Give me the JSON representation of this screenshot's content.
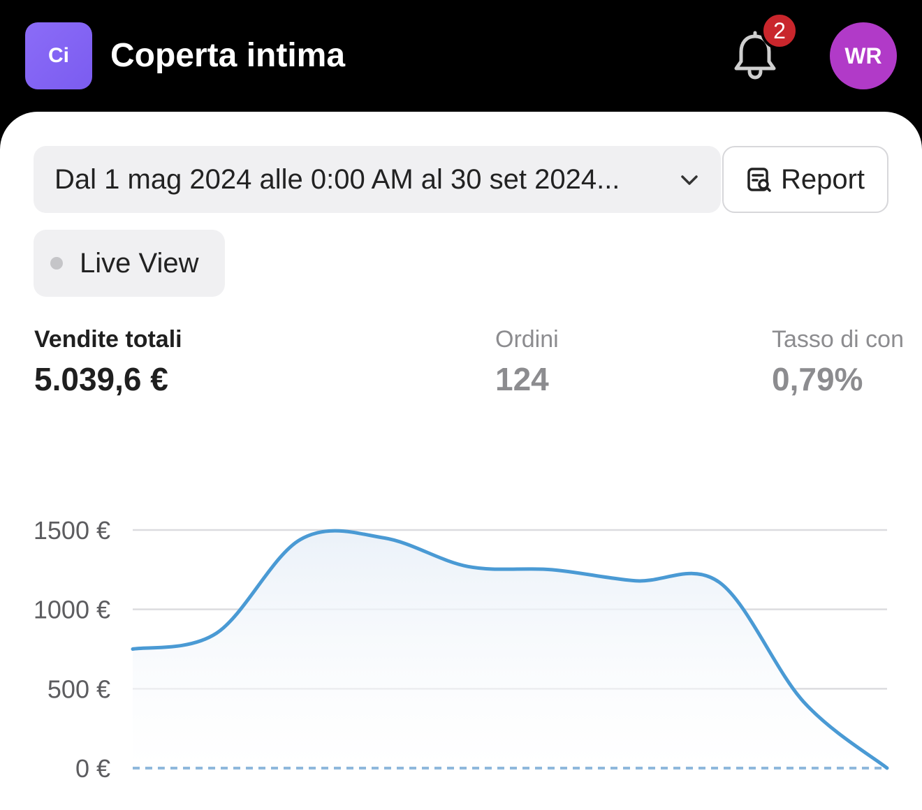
{
  "header": {
    "store_initials": "Ci",
    "store_name": "Coperta intima",
    "notification_count": "2",
    "user_initials": "WR"
  },
  "filters": {
    "date_range": "Dal 1 mag 2024 alle 0:00 AM al 30 set 2024...",
    "report_label": "Report",
    "live_view_label": "Live View"
  },
  "metrics": [
    {
      "label": "Vendite totali",
      "value": "5.039,6 €"
    },
    {
      "label": "Ordini",
      "value": "124"
    },
    {
      "label": "Tasso di con",
      "value": "0,79%"
    }
  ],
  "colors": {
    "accent_logo": "#7b5cf0",
    "avatar": "#b13ac8",
    "badge": "#c9262c",
    "line": "#4a9ad4"
  },
  "chart_data": {
    "type": "area",
    "x": [
      0,
      1,
      2,
      3,
      4,
      5,
      6,
      7,
      8,
      9
    ],
    "series": [
      {
        "values": [
          750,
          850,
          1440,
          1450,
          1270,
          1250,
          1180,
          1170,
          420,
          0
        ]
      },
      {
        "values": [
          0,
          0,
          0,
          0,
          0,
          0,
          0,
          0,
          0,
          0
        ]
      }
    ],
    "y_ticks": [
      "1500 €",
      "1000 €",
      "500 €",
      "0 €"
    ],
    "y_tick_values": [
      1500,
      1000,
      500,
      0
    ],
    "ylim": [
      0,
      1500
    ],
    "grid": true
  }
}
